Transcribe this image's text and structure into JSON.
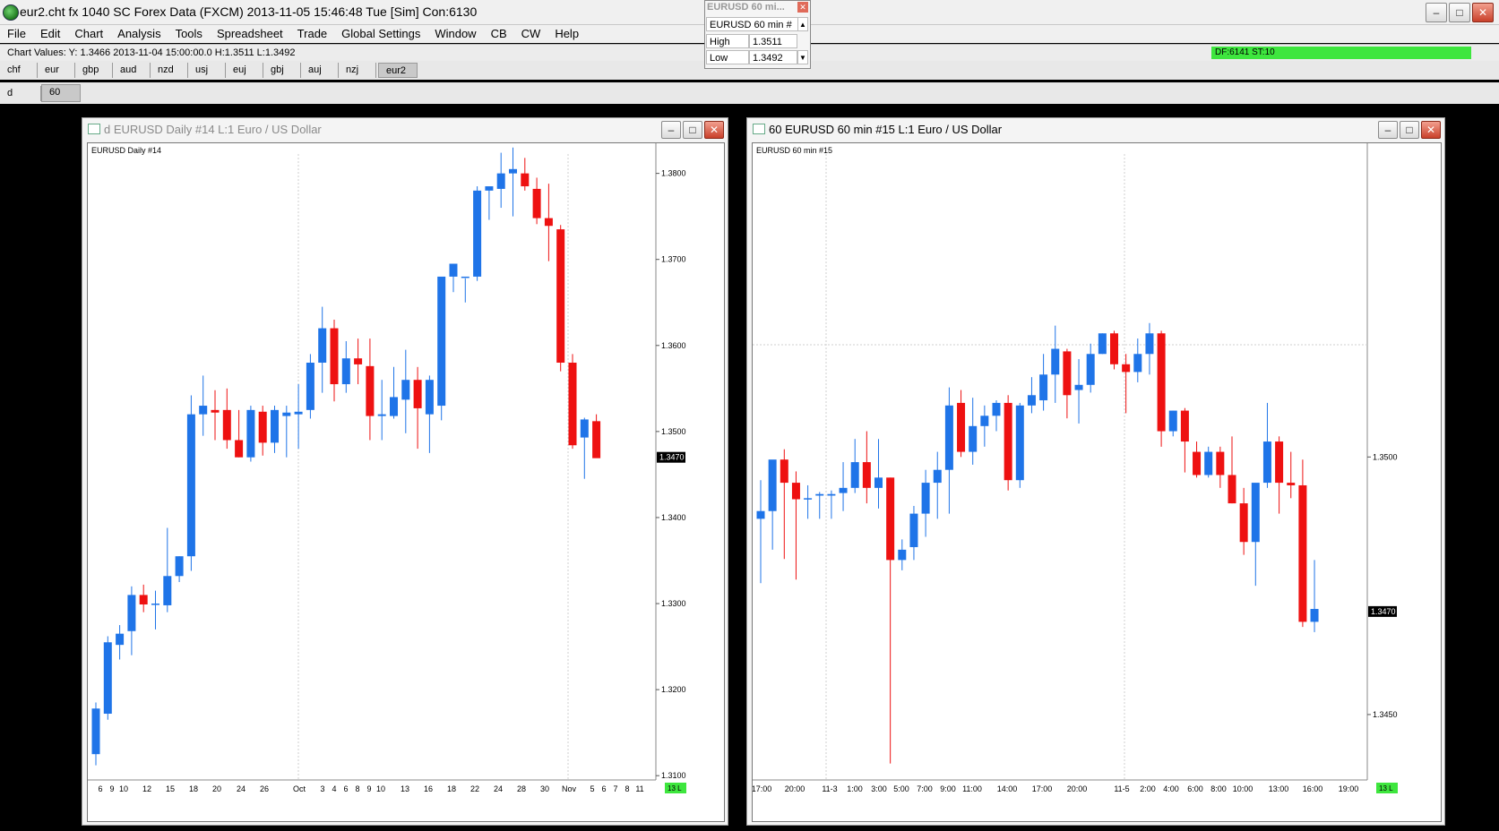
{
  "app": {
    "title": "eur2.cht  fx 1040 SC Forex Data (FXCM) 2013-11-05  15:46:48 Tue [Sim]  Con:6130",
    "menu": [
      "File",
      "Edit",
      "Chart",
      "Analysis",
      "Tools",
      "Spreadsheet",
      "Trade",
      "Global Settings",
      "Window",
      "CB",
      "CW",
      "Help"
    ],
    "chart_values": "Chart Values: Y: 1.3466  2013-11-04  15:00:00.0  H:1.3511  L:1.3492",
    "status": "DF:6141  ST:10",
    "tabs": [
      "chf",
      "eur",
      "gbp",
      "aud",
      "nzd",
      "usj",
      "euj",
      "gbj",
      "auj",
      "nzj",
      "eur2"
    ],
    "active_tab": "eur2",
    "interval_tabs": [
      "d",
      "60"
    ],
    "active_interval": "60"
  },
  "toolbox": {
    "title": "EURUSD  60 mi...",
    "symbol": "EURUSD  60 min   #",
    "high_label": "High",
    "high_value": "1.3511",
    "low_label": "Low",
    "low_value": "1.3492"
  },
  "colors": {
    "up": "#1f74e8",
    "down": "#ee1111",
    "status_green": "#3ee63e"
  },
  "chart_data": [
    {
      "type": "candlestick",
      "title": "d  EURUSD  Daily  #14  L:1  Euro / US Dollar",
      "subtitle": "EURUSD  Daily  #14",
      "ylim": [
        1.3095,
        1.3835
      ],
      "y_ticks": [
        "1.3800",
        "1.3700",
        "1.3600",
        "1.3500",
        "1.3400",
        "1.3300",
        "1.3200",
        "1.3100"
      ],
      "last_price": "1.3470",
      "x_labels": [
        "6",
        "9",
        "10",
        "12",
        "15",
        "18",
        "20",
        "24",
        "26",
        "Oct",
        "3",
        "4",
        "6",
        "8",
        "9",
        "10",
        "13",
        "16",
        "18",
        "22",
        "24",
        "28",
        "30",
        "Nov",
        "5",
        "6",
        "7",
        "8",
        "11"
      ],
      "footer_badge": "13 L",
      "candles": [
        [
          1.3125,
          1.3185,
          1.3112,
          1.3178
        ],
        [
          1.3172,
          1.3262,
          1.3165,
          1.3255
        ],
        [
          1.3252,
          1.3275,
          1.3235,
          1.3265
        ],
        [
          1.3268,
          1.332,
          1.324,
          1.331
        ],
        [
          1.331,
          1.3322,
          1.329,
          1.3299
        ],
        [
          1.33,
          1.3315,
          1.327,
          1.33
        ],
        [
          1.3298,
          1.3388,
          1.329,
          1.3332
        ],
        [
          1.3332,
          1.3355,
          1.3325,
          1.3355
        ],
        [
          1.3355,
          1.3542,
          1.3338,
          1.352
        ],
        [
          1.352,
          1.3565,
          1.3495,
          1.353
        ],
        [
          1.3525,
          1.3548,
          1.349,
          1.3522
        ],
        [
          1.3525,
          1.355,
          1.348,
          1.349
        ],
        [
          1.349,
          1.3525,
          1.347,
          1.347
        ],
        [
          1.347,
          1.353,
          1.3465,
          1.3525
        ],
        [
          1.3523,
          1.353,
          1.3472,
          1.3487
        ],
        [
          1.3487,
          1.353,
          1.3475,
          1.3525
        ],
        [
          1.3518,
          1.353,
          1.347,
          1.3522
        ],
        [
          1.352,
          1.3555,
          1.348,
          1.3523
        ],
        [
          1.3525,
          1.359,
          1.3515,
          1.358
        ],
        [
          1.358,
          1.3645,
          1.3545,
          1.362
        ],
        [
          1.362,
          1.363,
          1.3535,
          1.3555
        ],
        [
          1.3555,
          1.3605,
          1.3545,
          1.3585
        ],
        [
          1.3585,
          1.3608,
          1.3555,
          1.3578
        ],
        [
          1.3576,
          1.3608,
          1.349,
          1.3518
        ],
        [
          1.3518,
          1.356,
          1.349,
          1.352
        ],
        [
          1.3518,
          1.3575,
          1.3515,
          1.354
        ],
        [
          1.3537,
          1.3595,
          1.3498,
          1.356
        ],
        [
          1.356,
          1.3575,
          1.348,
          1.3527
        ],
        [
          1.352,
          1.3565,
          1.3475,
          1.356
        ],
        [
          1.353,
          1.3675,
          1.3513,
          1.368
        ],
        [
          1.368,
          1.3695,
          1.3662,
          1.3695
        ],
        [
          1.368,
          1.3678,
          1.365,
          1.368
        ],
        [
          1.368,
          1.3785,
          1.3675,
          1.378
        ],
        [
          1.378,
          1.3783,
          1.3746,
          1.3785
        ],
        [
          1.3782,
          1.3824,
          1.376,
          1.38
        ],
        [
          1.38,
          1.383,
          1.375,
          1.3805
        ],
        [
          1.38,
          1.3818,
          1.378,
          1.3785
        ],
        [
          1.3782,
          1.3795,
          1.3741,
          1.3748
        ],
        [
          1.3748,
          1.3788,
          1.3698,
          1.3739
        ],
        [
          1.3735,
          1.374,
          1.357,
          1.358
        ],
        [
          1.358,
          1.359,
          1.348,
          1.3484
        ],
        [
          1.3493,
          1.3516,
          1.3445,
          1.3514
        ],
        [
          1.3512,
          1.352,
          1.3475,
          1.3469
        ]
      ]
    },
    {
      "type": "candlestick",
      "title": "60  EURUSD  60 min   #15  L:1  Euro / US Dollar",
      "subtitle": "EURUSD  60 min   #15",
      "ylim": [
        1.34373,
        1.35609
      ],
      "y_ticks": [
        "1.3500",
        "1.3450"
      ],
      "last_price": "1.3470",
      "x_labels": [
        "17:00",
        "20:00",
        "11-3",
        "1:00",
        "3:00",
        "5:00",
        "7:00",
        "9:00",
        "11:00",
        "14:00",
        "17:00",
        "20:00",
        "11-5",
        "2:00",
        "4:00",
        "6:00",
        "8:00",
        "10:00",
        "13:00",
        "16:00",
        "19:00"
      ],
      "footer_badge": "13 L",
      "candles": [
        [
          1.3488,
          1.34955,
          1.34755,
          1.34895
        ],
        [
          1.34895,
          1.3497,
          1.3482,
          1.34995
        ],
        [
          1.34995,
          1.35015,
          1.34802,
          1.3495
        ],
        [
          1.3495,
          1.34972,
          1.34762,
          1.34918
        ],
        [
          1.34918,
          1.34945,
          1.3488,
          1.3492
        ],
        [
          1.34925,
          1.34932,
          1.3488,
          1.34928
        ],
        [
          1.34925,
          1.34935,
          1.3488,
          1.34928
        ],
        [
          1.3493,
          1.3499,
          1.34895,
          1.3494
        ],
        [
          1.3494,
          1.35035,
          1.3493,
          1.3499
        ],
        [
          1.3499,
          1.3505,
          1.3491,
          1.3494
        ],
        [
          1.3494,
          1.35035,
          1.349,
          1.3496
        ],
        [
          1.3496,
          1.3496,
          1.34405,
          1.348
        ],
        [
          1.348,
          1.3484,
          1.3478,
          1.3482
        ],
        [
          1.34825,
          1.34905,
          1.348,
          1.3489
        ],
        [
          1.3489,
          1.34975,
          1.34845,
          1.3495
        ],
        [
          1.3495,
          1.3501,
          1.3488,
          1.34975
        ],
        [
          1.34975,
          1.35135,
          1.3489,
          1.351
        ],
        [
          1.35105,
          1.3513,
          1.35,
          1.3501
        ],
        [
          1.3501,
          1.35115,
          1.34985,
          1.3506
        ],
        [
          1.3506,
          1.351,
          1.3502,
          1.3508
        ],
        [
          1.3508,
          1.3511,
          1.3505,
          1.35105
        ],
        [
          1.35105,
          1.3512,
          1.34935,
          1.34955
        ],
        [
          1.34955,
          1.35105,
          1.3494,
          1.351
        ],
        [
          1.351,
          1.35155,
          1.35085,
          1.3512
        ],
        [
          1.3511,
          1.352,
          1.3509,
          1.3516
        ],
        [
          1.3516,
          1.35255,
          1.35105,
          1.3521
        ],
        [
          1.35205,
          1.3521,
          1.35075,
          1.3512
        ],
        [
          1.3513,
          1.3519,
          1.35065,
          1.3514
        ],
        [
          1.3514,
          1.3522,
          1.35125,
          1.352
        ],
        [
          1.352,
          1.3524,
          1.352,
          1.3524
        ],
        [
          1.3524,
          1.35245,
          1.3517,
          1.3518
        ],
        [
          1.3518,
          1.352,
          1.35085,
          1.35165
        ],
        [
          1.35165,
          1.3523,
          1.35145,
          1.352
        ],
        [
          1.352,
          1.3526,
          1.3516,
          1.3524
        ],
        [
          1.3524,
          1.35245,
          1.3502,
          1.3505
        ],
        [
          1.3505,
          1.3509,
          1.3504,
          1.3509
        ],
        [
          1.3509,
          1.35095,
          1.3497,
          1.3503
        ],
        [
          1.3501,
          1.3503,
          1.3496,
          1.34965
        ],
        [
          1.34965,
          1.3502,
          1.3496,
          1.3501
        ],
        [
          1.3501,
          1.3502,
          1.3494,
          1.34965
        ],
        [
          1.34965,
          1.3504,
          1.3491,
          1.3491
        ],
        [
          1.3491,
          1.3494,
          1.3481,
          1.34835
        ],
        [
          1.34835,
          1.34945,
          1.3475,
          1.3495
        ],
        [
          1.3495,
          1.35105,
          1.3494,
          1.3503
        ],
        [
          1.3503,
          1.3504,
          1.3489,
          1.3495
        ],
        [
          1.3495,
          1.3501,
          1.3492,
          1.34945
        ],
        [
          1.34945,
          1.34995,
          1.3467,
          1.3468
        ],
        [
          1.3468,
          1.348,
          1.3466,
          1.34705
        ]
      ]
    }
  ]
}
